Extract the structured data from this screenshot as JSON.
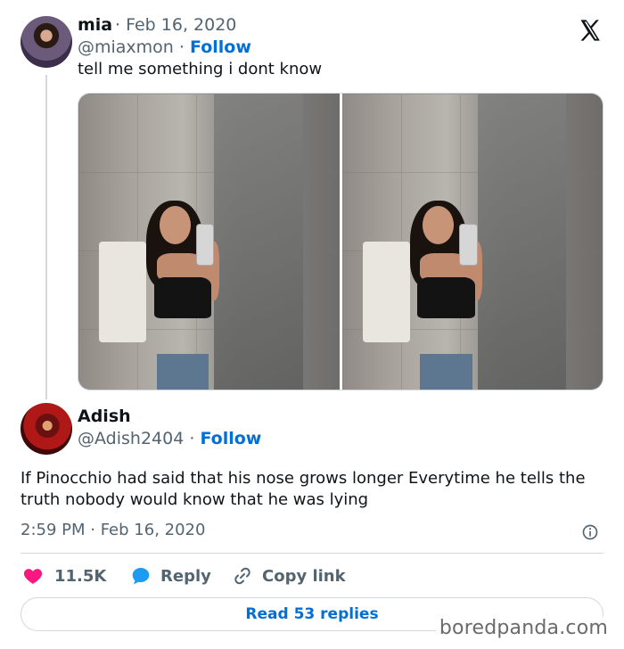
{
  "tweet": {
    "author_name": "mia",
    "date": "Feb 16, 2020",
    "handle": "@miaxmon",
    "follow_label": "Follow",
    "text": "tell me something i dont know",
    "media": [
      "photo-1",
      "photo-2"
    ]
  },
  "reply": {
    "author_name": "Adish",
    "handle": "@Adish2404",
    "follow_label": "Follow",
    "text_line1": "If Pinocchio had said that his nose grows longer Everytime he tells the",
    "text_line2": "truth nobody would know that he was lying",
    "timestamp": "2:59 PM · Feb 16, 2020"
  },
  "actions": {
    "likes": "11.5K",
    "reply_label": "Reply",
    "copy_link_label": "Copy link",
    "read_replies_label": "Read 53 replies"
  },
  "brand": {
    "logo": "x-logo",
    "watermark": "boredpanda.com"
  },
  "colors": {
    "accent": "#006fd6",
    "like": "#f91880",
    "reply_icon": "#1d9bf0",
    "muted": "#536471",
    "text": "#0f1419"
  }
}
